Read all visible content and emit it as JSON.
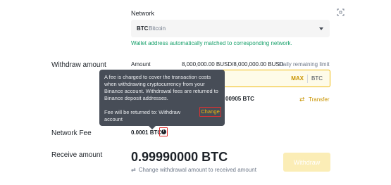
{
  "network": {
    "label": "Network",
    "selected_code": "BTC",
    "selected_name": "Bitcoin",
    "matched_note": "Wallet address automatically matched to corresponding network."
  },
  "withdraw": {
    "side_label": "Withdraw amount",
    "amount_label": "Amount",
    "limit_value": "8,000,000.00 BUSD/8,000,000.00 BUSD",
    "limit_label": "Daily remaining limit",
    "max_label": "MAX",
    "unit": "BTC",
    "available_partial": "00905 BTC",
    "transfer_label": "Transfer"
  },
  "tooltip": {
    "text": "A fee is charged to cover the transaction costs when withdrawing cryptocurrency from your Binance account. Withdrawal fees are returned to Binance deposit addresses.",
    "fee_returned": "Fee will be returned to: Withdraw account",
    "change_label": "Change"
  },
  "fee": {
    "side_label": "Network Fee",
    "value": "0.0001 BTC"
  },
  "receive": {
    "side_label": "Receive amount",
    "value": "0.99990000 BTC",
    "change_note": "Change withdrawal amount to received amount"
  },
  "withdraw_button": "Withdraw",
  "icons": {
    "scan": "qr-scan-icon",
    "caret": "chevron-down-icon",
    "info": "info-icon",
    "transfer": "transfer-arrows-icon",
    "swap": "swap-arrows-icon"
  },
  "colors": {
    "accent": "#f0b90b",
    "success": "#16a06a",
    "highlight_border": "#e03131",
    "tooltip_bg": "#474d57"
  }
}
